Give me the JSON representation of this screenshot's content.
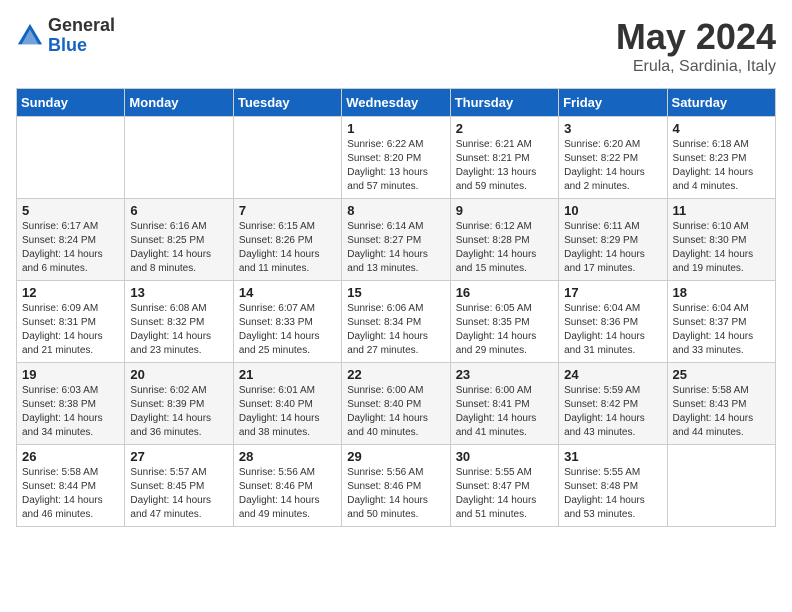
{
  "header": {
    "logo_general": "General",
    "logo_blue": "Blue",
    "month_year": "May 2024",
    "location": "Erula, Sardinia, Italy"
  },
  "days_of_week": [
    "Sunday",
    "Monday",
    "Tuesday",
    "Wednesday",
    "Thursday",
    "Friday",
    "Saturday"
  ],
  "weeks": [
    [
      {
        "num": "",
        "info": ""
      },
      {
        "num": "",
        "info": ""
      },
      {
        "num": "",
        "info": ""
      },
      {
        "num": "1",
        "info": "Sunrise: 6:22 AM\nSunset: 8:20 PM\nDaylight: 13 hours\nand 57 minutes."
      },
      {
        "num": "2",
        "info": "Sunrise: 6:21 AM\nSunset: 8:21 PM\nDaylight: 13 hours\nand 59 minutes."
      },
      {
        "num": "3",
        "info": "Sunrise: 6:20 AM\nSunset: 8:22 PM\nDaylight: 14 hours\nand 2 minutes."
      },
      {
        "num": "4",
        "info": "Sunrise: 6:18 AM\nSunset: 8:23 PM\nDaylight: 14 hours\nand 4 minutes."
      }
    ],
    [
      {
        "num": "5",
        "info": "Sunrise: 6:17 AM\nSunset: 8:24 PM\nDaylight: 14 hours\nand 6 minutes."
      },
      {
        "num": "6",
        "info": "Sunrise: 6:16 AM\nSunset: 8:25 PM\nDaylight: 14 hours\nand 8 minutes."
      },
      {
        "num": "7",
        "info": "Sunrise: 6:15 AM\nSunset: 8:26 PM\nDaylight: 14 hours\nand 11 minutes."
      },
      {
        "num": "8",
        "info": "Sunrise: 6:14 AM\nSunset: 8:27 PM\nDaylight: 14 hours\nand 13 minutes."
      },
      {
        "num": "9",
        "info": "Sunrise: 6:12 AM\nSunset: 8:28 PM\nDaylight: 14 hours\nand 15 minutes."
      },
      {
        "num": "10",
        "info": "Sunrise: 6:11 AM\nSunset: 8:29 PM\nDaylight: 14 hours\nand 17 minutes."
      },
      {
        "num": "11",
        "info": "Sunrise: 6:10 AM\nSunset: 8:30 PM\nDaylight: 14 hours\nand 19 minutes."
      }
    ],
    [
      {
        "num": "12",
        "info": "Sunrise: 6:09 AM\nSunset: 8:31 PM\nDaylight: 14 hours\nand 21 minutes."
      },
      {
        "num": "13",
        "info": "Sunrise: 6:08 AM\nSunset: 8:32 PM\nDaylight: 14 hours\nand 23 minutes."
      },
      {
        "num": "14",
        "info": "Sunrise: 6:07 AM\nSunset: 8:33 PM\nDaylight: 14 hours\nand 25 minutes."
      },
      {
        "num": "15",
        "info": "Sunrise: 6:06 AM\nSunset: 8:34 PM\nDaylight: 14 hours\nand 27 minutes."
      },
      {
        "num": "16",
        "info": "Sunrise: 6:05 AM\nSunset: 8:35 PM\nDaylight: 14 hours\nand 29 minutes."
      },
      {
        "num": "17",
        "info": "Sunrise: 6:04 AM\nSunset: 8:36 PM\nDaylight: 14 hours\nand 31 minutes."
      },
      {
        "num": "18",
        "info": "Sunrise: 6:04 AM\nSunset: 8:37 PM\nDaylight: 14 hours\nand 33 minutes."
      }
    ],
    [
      {
        "num": "19",
        "info": "Sunrise: 6:03 AM\nSunset: 8:38 PM\nDaylight: 14 hours\nand 34 minutes."
      },
      {
        "num": "20",
        "info": "Sunrise: 6:02 AM\nSunset: 8:39 PM\nDaylight: 14 hours\nand 36 minutes."
      },
      {
        "num": "21",
        "info": "Sunrise: 6:01 AM\nSunset: 8:40 PM\nDaylight: 14 hours\nand 38 minutes."
      },
      {
        "num": "22",
        "info": "Sunrise: 6:00 AM\nSunset: 8:40 PM\nDaylight: 14 hours\nand 40 minutes."
      },
      {
        "num": "23",
        "info": "Sunrise: 6:00 AM\nSunset: 8:41 PM\nDaylight: 14 hours\nand 41 minutes."
      },
      {
        "num": "24",
        "info": "Sunrise: 5:59 AM\nSunset: 8:42 PM\nDaylight: 14 hours\nand 43 minutes."
      },
      {
        "num": "25",
        "info": "Sunrise: 5:58 AM\nSunset: 8:43 PM\nDaylight: 14 hours\nand 44 minutes."
      }
    ],
    [
      {
        "num": "26",
        "info": "Sunrise: 5:58 AM\nSunset: 8:44 PM\nDaylight: 14 hours\nand 46 minutes."
      },
      {
        "num": "27",
        "info": "Sunrise: 5:57 AM\nSunset: 8:45 PM\nDaylight: 14 hours\nand 47 minutes."
      },
      {
        "num": "28",
        "info": "Sunrise: 5:56 AM\nSunset: 8:46 PM\nDaylight: 14 hours\nand 49 minutes."
      },
      {
        "num": "29",
        "info": "Sunrise: 5:56 AM\nSunset: 8:46 PM\nDaylight: 14 hours\nand 50 minutes."
      },
      {
        "num": "30",
        "info": "Sunrise: 5:55 AM\nSunset: 8:47 PM\nDaylight: 14 hours\nand 51 minutes."
      },
      {
        "num": "31",
        "info": "Sunrise: 5:55 AM\nSunset: 8:48 PM\nDaylight: 14 hours\nand 53 minutes."
      },
      {
        "num": "",
        "info": ""
      }
    ]
  ]
}
